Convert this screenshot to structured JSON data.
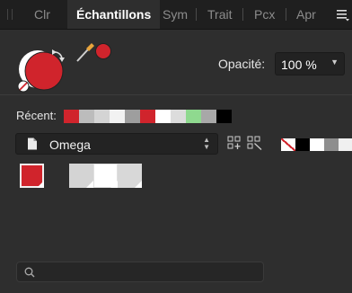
{
  "tabs": [
    {
      "label": "Clr",
      "active": false
    },
    {
      "label": "Échantillons",
      "active": true
    },
    {
      "label": "Sym",
      "active": false
    },
    {
      "label": "Trait",
      "active": false
    },
    {
      "label": "Pcx",
      "active": false
    },
    {
      "label": "Apr",
      "active": false
    }
  ],
  "icons": {
    "menu": "hamburger-menu-icon",
    "swap": "swap-arrows-icon",
    "none": "no-color-icon",
    "picker": "eyedropper-icon",
    "document": "document-icon",
    "add_swatch": "add-swatch-grid-icon",
    "remove_swatch": "remove-swatch-grid-icon",
    "search": "magnifier-icon"
  },
  "fill_color": "#d0242c",
  "picker_color": "#d0242c",
  "opacity": {
    "label": "Opacité:",
    "value": "100 %"
  },
  "recent": {
    "label": "Récent:",
    "colors": [
      "#d0242c",
      "#bcbcbc",
      "#d4d4d4",
      "#f2f2f2",
      "#9e9e9e",
      "#d0242c",
      "#ffffff",
      "#dcdcdc",
      "#8fd98f",
      "#a8a8a8",
      "#000000"
    ]
  },
  "palette": {
    "name": "Omega"
  },
  "mini_swatches": [
    "none",
    "#000000",
    "#ffffff",
    "#8e8e8e",
    "#f0f0f0"
  ],
  "swatches": [
    "#d0242c",
    "#d4d4d4",
    "#ffffff",
    "#d8d8d8"
  ],
  "search": {
    "value": "",
    "placeholder": ""
  }
}
